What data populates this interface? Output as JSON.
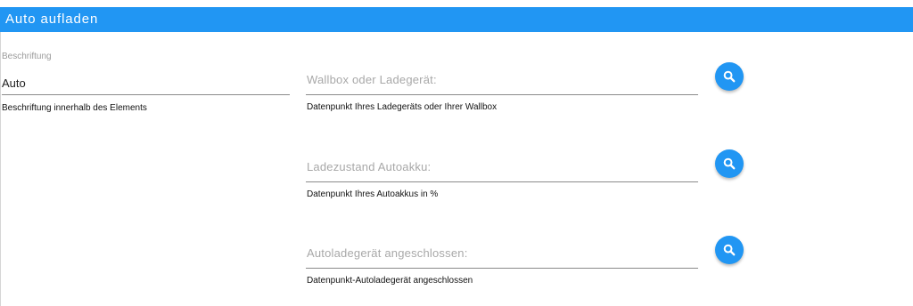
{
  "dialog": {
    "title": "Auto aufladen"
  },
  "caption": {
    "label": "Beschriftung",
    "value": "Auto",
    "helper": "Beschriftung innerhalb des Elements"
  },
  "datapoints": [
    {
      "placeholder": "Wallbox oder Ladegerät:",
      "helper": "Datenpunkt Ihres Ladegeräts oder Ihrer Wallbox",
      "button_icon": "search-icon"
    },
    {
      "placeholder": "Ladezustand Autoakku:",
      "helper": "Datenpunkt Ihres Autoakkus in %",
      "button_icon": "search-icon"
    },
    {
      "placeholder": "Autoladegerät angeschlossen:",
      "helper": "Datenpunkt-Autoladegerät angeschlossen",
      "button_icon": "search-icon"
    }
  ],
  "colors": {
    "accent": "#2196f3",
    "divider": "#8a8a8a",
    "placeholder": "#a8a8a8"
  }
}
